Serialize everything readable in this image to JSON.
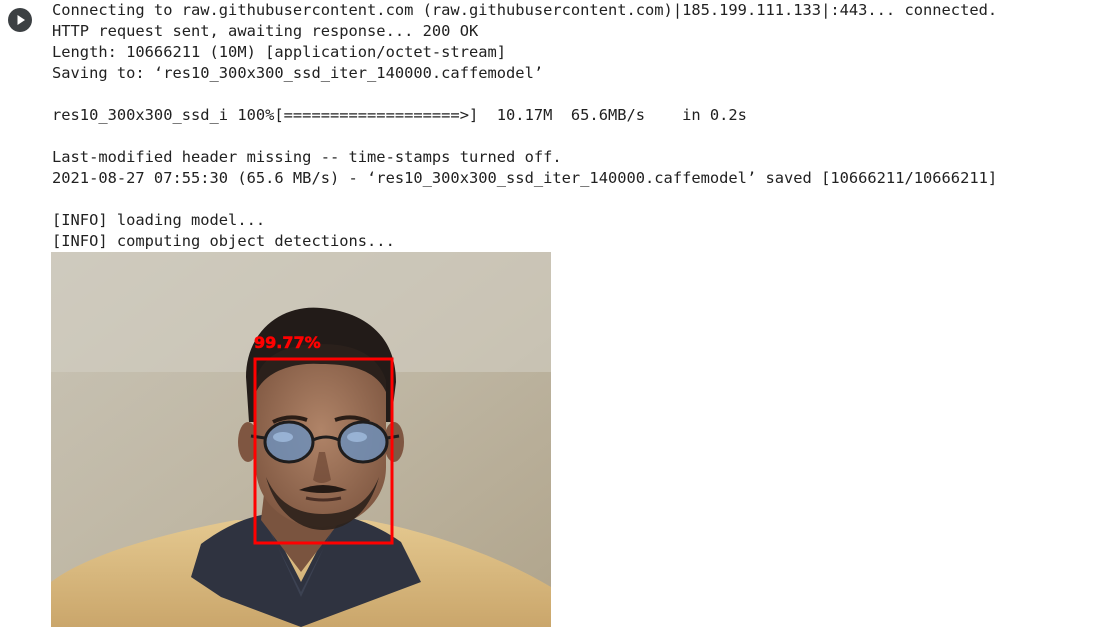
{
  "cell": {
    "run_button_icon": "play-icon"
  },
  "output": {
    "lines": [
      "Connecting to raw.githubusercontent.com (raw.githubusercontent.com)|185.199.111.133|:443... connected.",
      "HTTP request sent, awaiting response... 200 OK",
      "Length: 10666211 (10M) [application/octet-stream]",
      "Saving to: ‘res10_300x300_ssd_iter_140000.caffemodel’",
      "",
      "res10_300x300_ssd_i 100%[===================>]  10.17M  65.6MB/s    in 0.2s",
      "",
      "Last-modified header missing -- time-stamps turned off.",
      "2021-08-27 07:55:30 (65.6 MB/s) - ‘res10_300x300_ssd_iter_140000.caffemodel’ saved [10666211/10666211]",
      "",
      "[INFO] loading model...",
      "[INFO] computing object detections..."
    ]
  },
  "detection": {
    "confidence_label": "99.77%",
    "box_color": "#ff0000"
  }
}
